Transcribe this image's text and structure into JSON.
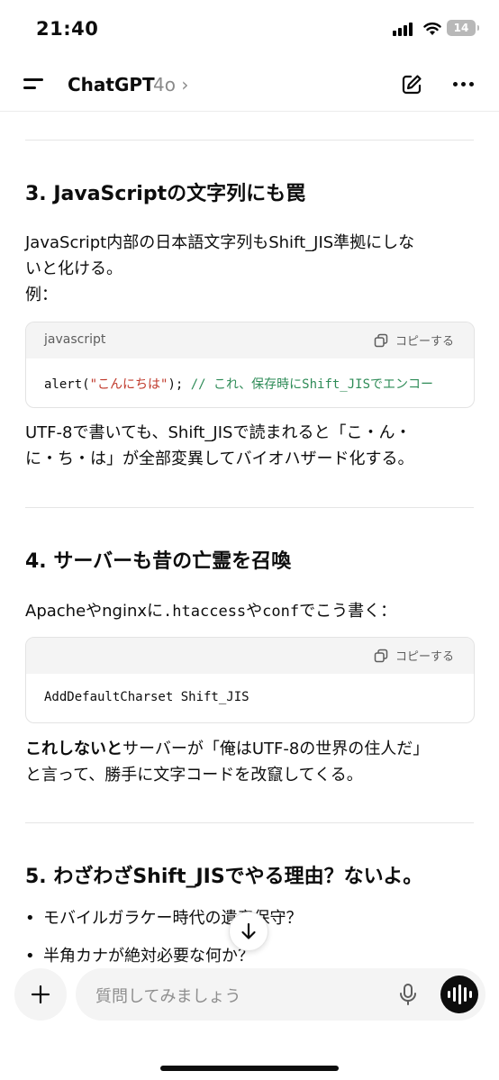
{
  "status_bar": {
    "time": "21:40",
    "battery": "14"
  },
  "header": {
    "title": "ChatGPT",
    "model": "4o",
    "chevron": "›"
  },
  "sections": {
    "js": {
      "heading": "3. JavaScriptの文字列にも罠",
      "para_line1": "JavaScript内部の日本語文字列もShift_JIS準拠にしな",
      "para_line2": "いと化ける。",
      "para_line3": "例：",
      "code": {
        "lang": "javascript",
        "copy_label": "コピーする",
        "fn": "alert(",
        "str": "\"こんにちは\"",
        "rest": ");",
        "comment": "// これ、保存時にShift_JISでエンコー"
      },
      "after_line1": "UTF-8で書いても、Shift_JISで読まれると「こ・ん・",
      "after_line2": "に・ち・は」が全部変異してバイオハザード化する。"
    },
    "server": {
      "heading": "4. サーバーも昔の亡霊を召喚",
      "intro_part1": "Apacheやnginxに",
      "intro_code1": ".htaccess",
      "intro_part2": "や",
      "intro_code2": "conf",
      "intro_part3": "でこう書く：",
      "code": {
        "copy_label": "コピーする",
        "line": "AddDefaultCharset Shift_JIS"
      },
      "after_bold": "これしないと",
      "after_line1": "サーバーが「俺はUTF-8の世界の住人だ」",
      "after_line2": "と言って、勝手に文字コードを改竄してくる。"
    },
    "reason": {
      "heading": "5. わざわざShift_JISでやる理由？ないよ。",
      "items": [
        "モバイルガラケー時代の遺産保守？",
        "半角カナが絶対必要な何か？"
      ]
    }
  },
  "composer": {
    "placeholder": "質問してみましょう"
  },
  "icons": {
    "menu": "menu-icon",
    "edit": "edit-icon",
    "more": "more-icon",
    "copy": "copy-icon",
    "scroll": "arrow-down-icon",
    "plus": "plus-icon",
    "mic": "mic-icon",
    "voice": "voice-mode-icon"
  }
}
